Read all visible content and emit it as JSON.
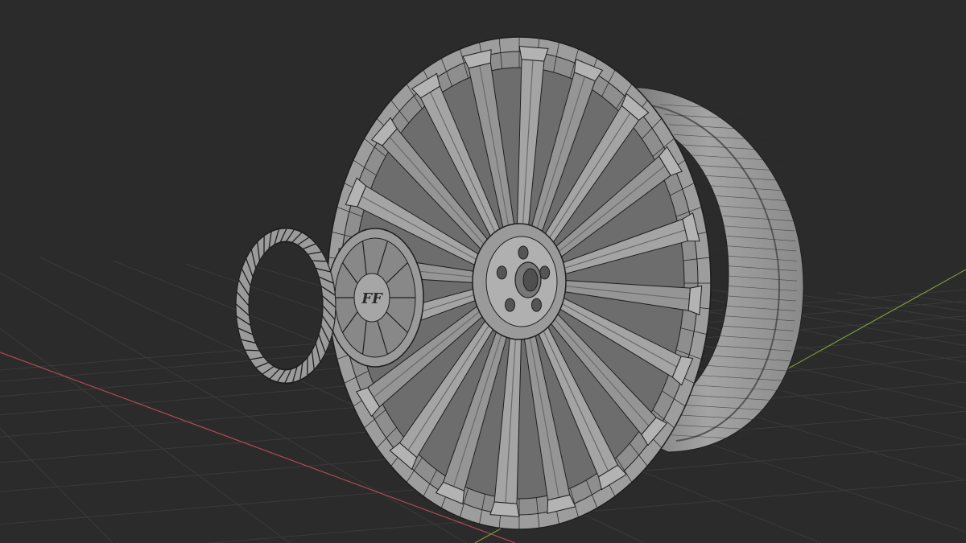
{
  "viewport": {
    "background_color": "#2b2b2b",
    "grid_line_color": "#3a3a3a",
    "x_axis_color": "#b04a55",
    "y_axis_color": "#7a9a3c"
  },
  "model": {
    "wireframe_color": "#1e1e1e",
    "surface_light": "#a9a9a9",
    "surface_mid": "#8d8d8d",
    "surface_dark": "#5f5f5f",
    "logo_glyph": "FF"
  }
}
